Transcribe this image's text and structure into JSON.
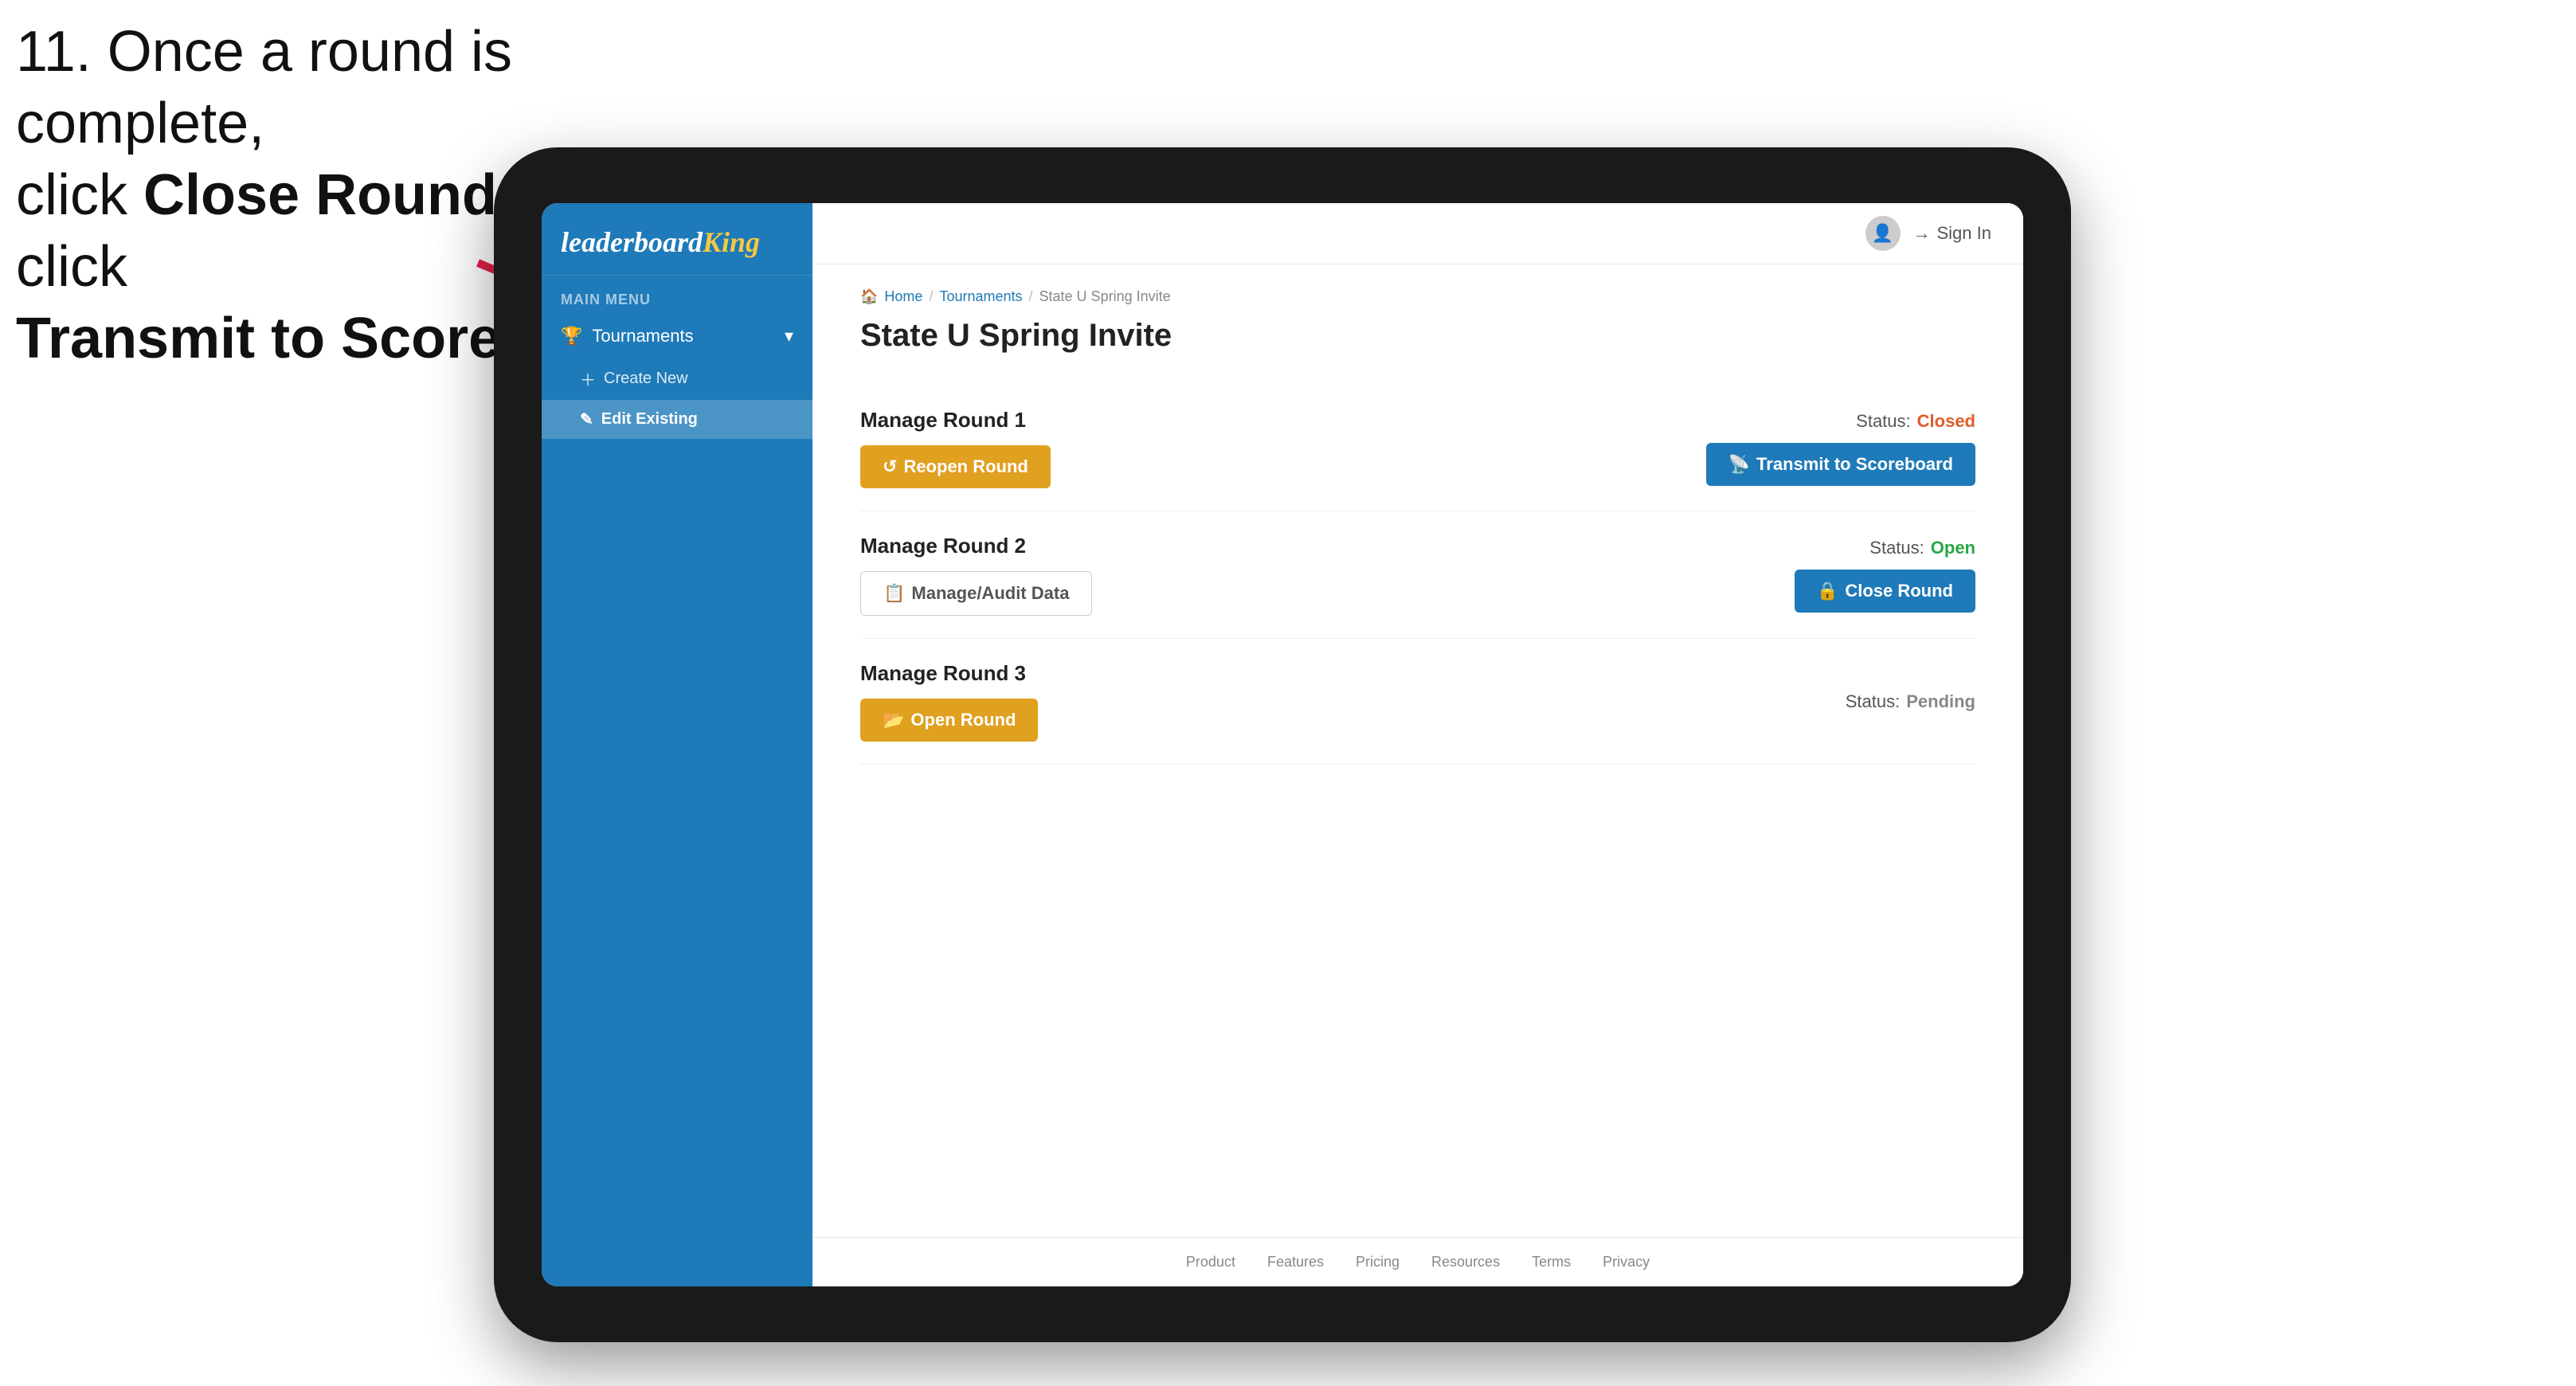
{
  "instruction": {
    "line1": "11. Once a round is complete,",
    "line2": "click ",
    "bold1": "Close Round",
    "line3": " then click",
    "bold2": "Transmit to Scoreboard."
  },
  "sidebar": {
    "logo": "leaderboard",
    "logo_accent": "King",
    "menu_label": "MAIN MENU",
    "tournaments_label": "Tournaments",
    "create_new_label": "Create New",
    "edit_existing_label": "Edit Existing"
  },
  "topbar": {
    "sign_in": "Sign In"
  },
  "breadcrumb": {
    "home": "Home",
    "sep1": "/",
    "tournaments": "Tournaments",
    "sep2": "/",
    "current": "State U Spring Invite"
  },
  "page": {
    "title": "State U Spring Invite"
  },
  "rounds": [
    {
      "id": 1,
      "title": "Manage Round 1",
      "status_label": "Status:",
      "status_value": "Closed",
      "status_class": "status-closed",
      "button1_label": "Reopen Round",
      "button1_class": "btn-amber",
      "button2_label": "Transmit to Scoreboard",
      "button2_class": "btn-blue",
      "show_button2": true
    },
    {
      "id": 2,
      "title": "Manage Round 2",
      "status_label": "Status:",
      "status_value": "Open",
      "status_class": "status-open",
      "button1_label": "Manage/Audit Data",
      "button1_class": "btn-outline",
      "button2_label": "Close Round",
      "button2_class": "btn-blue",
      "show_button2": true
    },
    {
      "id": 3,
      "title": "Manage Round 3",
      "status_label": "Status:",
      "status_value": "Pending",
      "status_class": "status-pending",
      "button1_label": "Open Round",
      "button1_class": "btn-amber",
      "button2_label": "",
      "show_button2": false
    }
  ],
  "footer": {
    "links": [
      "Product",
      "Features",
      "Pricing",
      "Resources",
      "Terms",
      "Privacy"
    ]
  }
}
